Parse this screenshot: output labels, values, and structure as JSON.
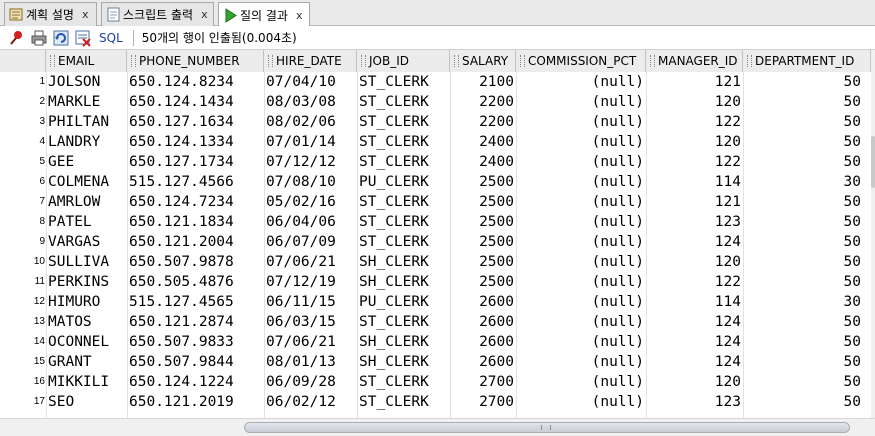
{
  "tabs": [
    {
      "label": "계획 설명",
      "icon": "explain-plan-icon",
      "close": "x"
    },
    {
      "label": "스크립트 출력",
      "icon": "script-output-icon",
      "close": "x"
    },
    {
      "label": "질의 결과",
      "icon": "run-query-icon",
      "close": "x"
    }
  ],
  "toolbar": {
    "icons": [
      "pin-icon",
      "print-icon",
      "refresh-icon",
      "clear-icon"
    ],
    "sql_label": "SQL",
    "status_text": "50개의 행이 인출됨(0.004초)"
  },
  "grid": {
    "columns": [
      "EMAIL",
      "PHONE_NUMBER",
      "HIRE_DATE",
      "JOB_ID",
      "SALARY",
      "COMMISSION_PCT",
      "MANAGER_ID",
      "DEPARTMENT_ID"
    ],
    "rows": [
      {
        "n": "1",
        "email": "JOLSON",
        "phone": "650.124.8234",
        "hire": "07/04/10",
        "job": "ST_CLERK",
        "salary": "2100",
        "comm": "(null)",
        "mgr": "121",
        "dept": "50"
      },
      {
        "n": "2",
        "email": "MARKLE",
        "phone": "650.124.1434",
        "hire": "08/03/08",
        "job": "ST_CLERK",
        "salary": "2200",
        "comm": "(null)",
        "mgr": "120",
        "dept": "50"
      },
      {
        "n": "3",
        "email": "PHILTAN",
        "phone": "650.127.1634",
        "hire": "08/02/06",
        "job": "ST_CLERK",
        "salary": "2200",
        "comm": "(null)",
        "mgr": "122",
        "dept": "50"
      },
      {
        "n": "4",
        "email": "LANDRY",
        "phone": "650.124.1334",
        "hire": "07/01/14",
        "job": "ST_CLERK",
        "salary": "2400",
        "comm": "(null)",
        "mgr": "120",
        "dept": "50"
      },
      {
        "n": "5",
        "email": "GEE",
        "phone": "650.127.1734",
        "hire": "07/12/12",
        "job": "ST_CLERK",
        "salary": "2400",
        "comm": "(null)",
        "mgr": "122",
        "dept": "50"
      },
      {
        "n": "6",
        "email": "COLMENA",
        "phone": "515.127.4566",
        "hire": "07/08/10",
        "job": "PU_CLERK",
        "salary": "2500",
        "comm": "(null)",
        "mgr": "114",
        "dept": "30"
      },
      {
        "n": "7",
        "email": "AMRLOW",
        "phone": "650.124.7234",
        "hire": "05/02/16",
        "job": "ST_CLERK",
        "salary": "2500",
        "comm": "(null)",
        "mgr": "121",
        "dept": "50"
      },
      {
        "n": "8",
        "email": "PATEL",
        "phone": "650.121.1834",
        "hire": "06/04/06",
        "job": "ST_CLERK",
        "salary": "2500",
        "comm": "(null)",
        "mgr": "123",
        "dept": "50"
      },
      {
        "n": "9",
        "email": "VARGAS",
        "phone": "650.121.2004",
        "hire": "06/07/09",
        "job": "ST_CLERK",
        "salary": "2500",
        "comm": "(null)",
        "mgr": "124",
        "dept": "50"
      },
      {
        "n": "10",
        "email": "SULLIVA",
        "phone": "650.507.9878",
        "hire": "07/06/21",
        "job": "SH_CLERK",
        "salary": "2500",
        "comm": "(null)",
        "mgr": "120",
        "dept": "50"
      },
      {
        "n": "11",
        "email": "PERKINS",
        "phone": "650.505.4876",
        "hire": "07/12/19",
        "job": "SH_CLERK",
        "salary": "2500",
        "comm": "(null)",
        "mgr": "122",
        "dept": "50"
      },
      {
        "n": "12",
        "email": "HIMURO",
        "phone": "515.127.4565",
        "hire": "06/11/15",
        "job": "PU_CLERK",
        "salary": "2600",
        "comm": "(null)",
        "mgr": "114",
        "dept": "30"
      },
      {
        "n": "13",
        "email": "MATOS",
        "phone": "650.121.2874",
        "hire": "06/03/15",
        "job": "ST_CLERK",
        "salary": "2600",
        "comm": "(null)",
        "mgr": "124",
        "dept": "50"
      },
      {
        "n": "14",
        "email": "OCONNEL",
        "phone": "650.507.9833",
        "hire": "07/06/21",
        "job": "SH_CLERK",
        "salary": "2600",
        "comm": "(null)",
        "mgr": "124",
        "dept": "50"
      },
      {
        "n": "15",
        "email": "GRANT",
        "phone": "650.507.9844",
        "hire": "08/01/13",
        "job": "SH_CLERK",
        "salary": "2600",
        "comm": "(null)",
        "mgr": "124",
        "dept": "50"
      },
      {
        "n": "16",
        "email": "MIKKILI",
        "phone": "650.124.1224",
        "hire": "06/09/28",
        "job": "ST_CLERK",
        "salary": "2700",
        "comm": "(null)",
        "mgr": "120",
        "dept": "50"
      },
      {
        "n": "17",
        "email": "SEO",
        "phone": "650.121.2019",
        "hire": "06/02/12",
        "job": "ST_CLERK",
        "salary": "2700",
        "comm": "(null)",
        "mgr": "123",
        "dept": "50"
      }
    ]
  }
}
